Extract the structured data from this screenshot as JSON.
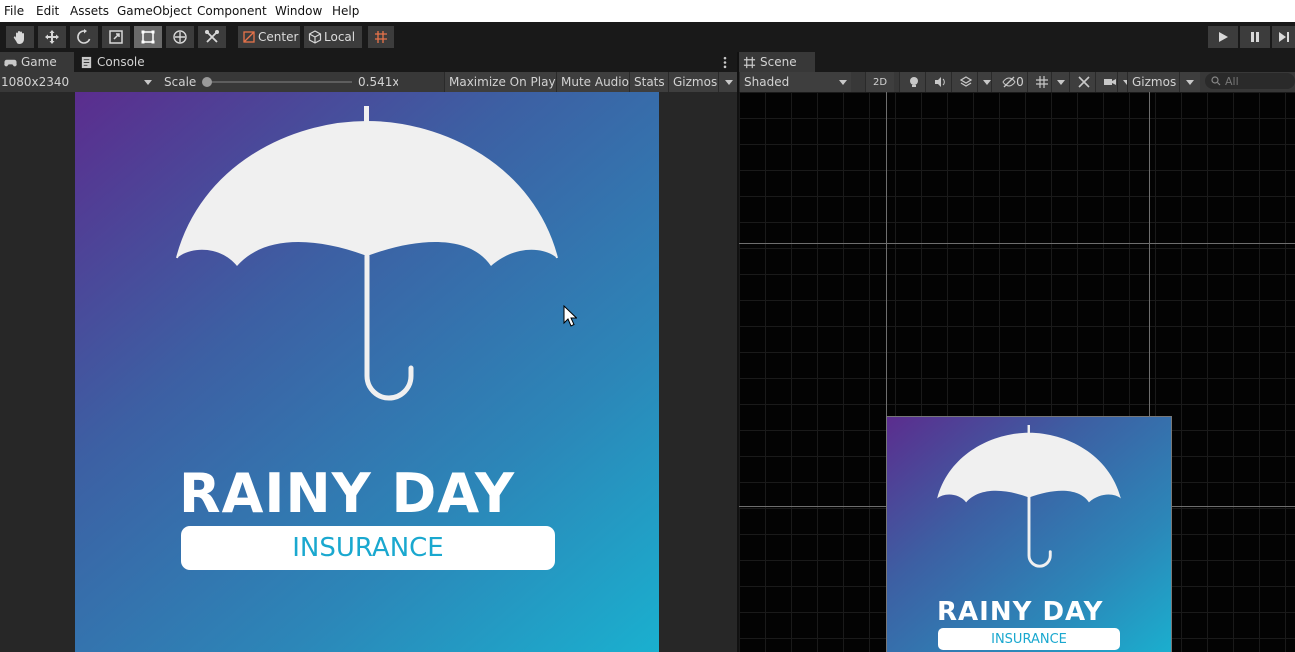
{
  "menubar": {
    "items": [
      "File",
      "Edit",
      "Assets",
      "GameObject",
      "Component",
      "Window",
      "Help"
    ]
  },
  "toolbar": {
    "tools": [
      "hand-tool",
      "move-tool",
      "rotate-tool",
      "scale-tool",
      "rect-tool",
      "transform-tool",
      "custom-tool"
    ],
    "active_tool": "rect-tool",
    "pivot_label": "Center",
    "space_label": "Local",
    "play_controls": [
      "play",
      "pause",
      "step"
    ]
  },
  "game_panel": {
    "tabs": [
      {
        "label": "Game",
        "icon": "gamepad-icon"
      },
      {
        "label": "Console",
        "icon": "console-icon"
      }
    ],
    "resolution": "1080x2340",
    "scale_label": "Scale",
    "scale_value": "0.541x",
    "scale_fraction": 0.0,
    "buttons": {
      "maximize": "Maximize On Play",
      "mute": "Mute Audio",
      "stats": "Stats",
      "gizmos": "Gizmos"
    }
  },
  "scene_panel": {
    "tab": {
      "label": "Scene",
      "icon": "grid-icon"
    },
    "shading_mode": "Shaded",
    "mode_2d": "2D",
    "hidden_count": "0",
    "gizmos": "Gizmos",
    "search_placeholder": "All"
  },
  "logo": {
    "title": "RAINY DAY",
    "subtitle": "INSURANCE"
  },
  "colors": {
    "gradient_start": "#5b2d8e",
    "gradient_end": "#1ab0cf",
    "accent": "#1aa8cf",
    "umbrella": "#f0f0f0"
  }
}
